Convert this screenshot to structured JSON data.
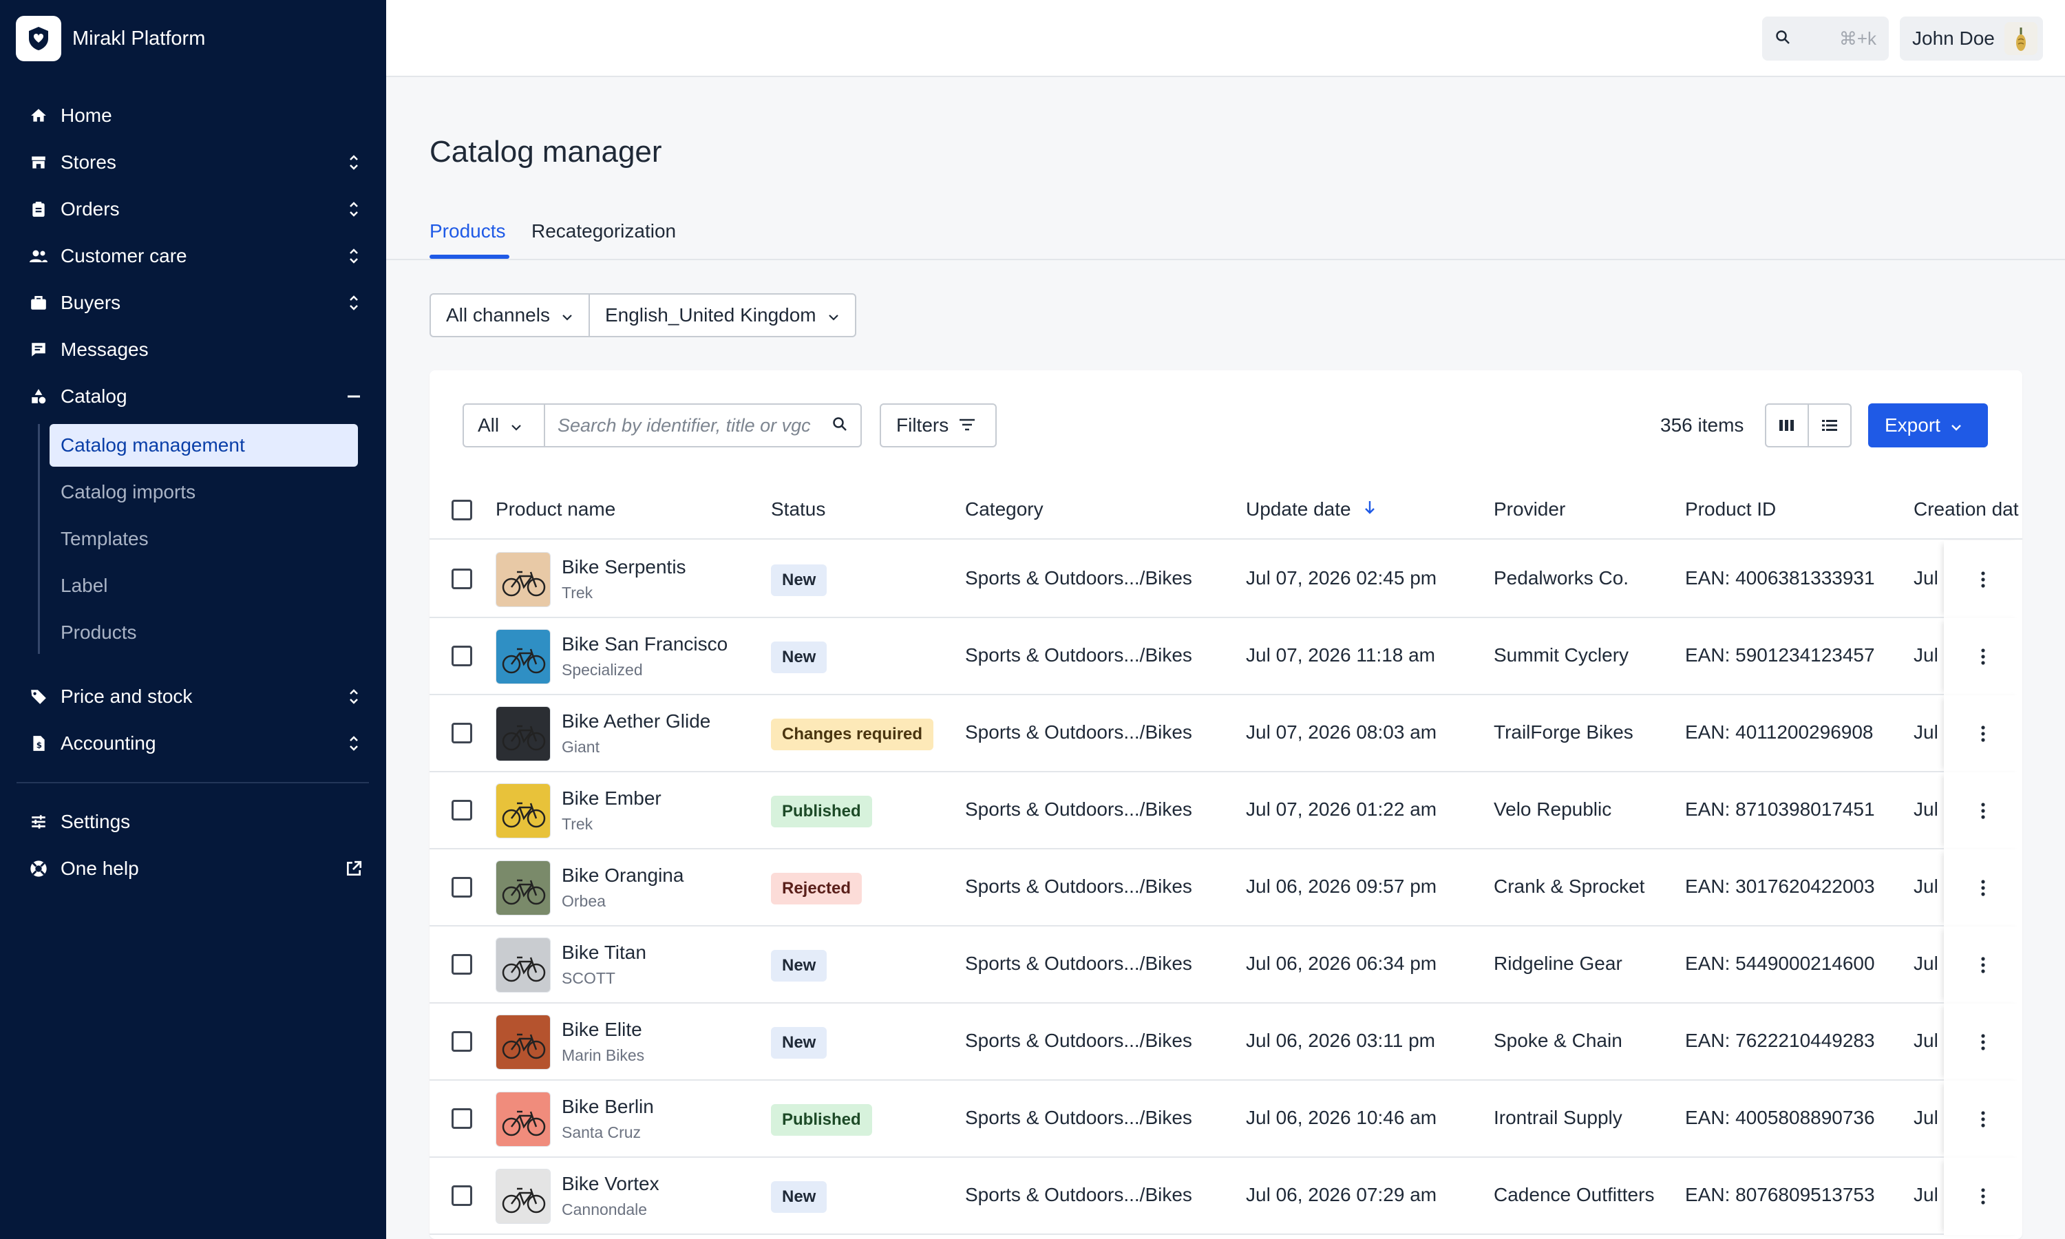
{
  "app": {
    "name": "Mirakl Platform"
  },
  "sidebar": {
    "items": [
      {
        "label": "Home",
        "icon": "home-icon"
      },
      {
        "label": "Stores",
        "icon": "store-icon"
      },
      {
        "label": "Orders",
        "icon": "clipboard-icon"
      },
      {
        "label": "Customer care",
        "icon": "people-icon"
      },
      {
        "label": "Buyers",
        "icon": "briefcase-icon"
      },
      {
        "label": "Messages",
        "icon": "message-icon"
      },
      {
        "label": "Catalog",
        "icon": "shapes-icon"
      },
      {
        "label": "Price and stock",
        "icon": "tag-icon"
      },
      {
        "label": "Accounting",
        "icon": "invoice-icon"
      },
      {
        "label": "Settings",
        "icon": "sliders-icon"
      },
      {
        "label": "One help",
        "icon": "lifebuoy-icon"
      }
    ],
    "catalog_sub": [
      {
        "label": "Catalog management",
        "active": true
      },
      {
        "label": "Catalog imports",
        "active": false
      },
      {
        "label": "Templates",
        "active": false
      },
      {
        "label": "Label",
        "active": false
      },
      {
        "label": "Products",
        "active": false
      }
    ]
  },
  "topbar": {
    "search_shortcut": "⌘+k",
    "user_name": "John Doe"
  },
  "page": {
    "title": "Catalog manager",
    "tabs": [
      {
        "label": "Products",
        "active": true
      },
      {
        "label": "Recategorization",
        "active": false
      }
    ],
    "channel_selector": "All channels",
    "locale_selector": "English_United Kingdom"
  },
  "toolbar": {
    "scope_filter": "All",
    "search_placeholder": "Search by identifier, title or vgc",
    "filters_label": "Filters",
    "items_count": "356 items",
    "export_label": "Export"
  },
  "table": {
    "columns": [
      "Product name",
      "Status",
      "Category",
      "Update date",
      "Provider",
      "Product ID",
      "Creation dat"
    ],
    "creation_cut": "Jul",
    "rows": [
      {
        "name": "Bike Serpentis",
        "brand": "Trek",
        "status": "New",
        "category": "Sports & Outdoors.../Bikes",
        "update": "Jul 07, 2026 02:45 pm",
        "provider": "Pedalworks Co.",
        "product_id": "EAN: 4006381333931",
        "thumb": "#e8c9a6"
      },
      {
        "name": "Bike San Francisco",
        "brand": "Specialized",
        "status": "New",
        "category": "Sports & Outdoors.../Bikes",
        "update": "Jul 07, 2026 11:18 am",
        "provider": "Summit Cyclery",
        "product_id": "EAN: 5901234123457",
        "thumb": "#2f8fc4"
      },
      {
        "name": "Bike Aether Glide",
        "brand": "Giant",
        "status": "Changes required",
        "category": "Sports & Outdoors.../Bikes",
        "update": "Jul 07, 2026 08:03 am",
        "provider": "TrailForge Bikes",
        "product_id": "EAN: 4011200296908",
        "thumb": "#2b2e33"
      },
      {
        "name": "Bike Ember",
        "brand": "Trek",
        "status": "Published",
        "category": "Sports & Outdoors.../Bikes",
        "update": "Jul 07, 2026 01:22 am",
        "provider": "Velo Republic",
        "product_id": "EAN: 8710398017451",
        "thumb": "#e8c23a"
      },
      {
        "name": "Bike Orangina",
        "brand": "Orbea",
        "status": "Rejected",
        "category": "Sports & Outdoors.../Bikes",
        "update": "Jul 06, 2026 09:57 pm",
        "provider": "Crank & Sprocket",
        "product_id": "EAN: 3017620422003",
        "thumb": "#7a8a6a"
      },
      {
        "name": "Bike Titan",
        "brand": "SCOTT",
        "status": "New",
        "category": "Sports & Outdoors.../Bikes",
        "update": "Jul 06, 2026 06:34 pm",
        "provider": "Ridgeline Gear",
        "product_id": "EAN: 5449000214600",
        "thumb": "#c9ccd0"
      },
      {
        "name": "Bike Elite",
        "brand": "Marin Bikes",
        "status": "New",
        "category": "Sports & Outdoors.../Bikes",
        "update": "Jul 06, 2026 03:11 pm",
        "provider": "Spoke & Chain",
        "product_id": "EAN: 7622210449283",
        "thumb": "#b5532e"
      },
      {
        "name": "Bike Berlin",
        "brand": "Santa Cruz",
        "status": "Published",
        "category": "Sports & Outdoors.../Bikes",
        "update": "Jul 06, 2026 10:46 am",
        "provider": "Irontrail Supply",
        "product_id": "EAN: 4005808890736",
        "thumb": "#f08c7c"
      },
      {
        "name": "Bike Vortex",
        "brand": "Cannondale",
        "status": "New",
        "category": "Sports & Outdoors.../Bikes",
        "update": "Jul 06, 2026 07:29 am",
        "provider": "Cadence Outfitters",
        "product_id": "EAN: 8076809513753",
        "thumb": "#e4e4e4"
      }
    ]
  },
  "status_colors": {
    "New": {
      "bg": "#e4ecf9",
      "fg": "#1f2937"
    },
    "Changes required": {
      "bg": "#fde9b8",
      "fg": "#4a3510"
    },
    "Published": {
      "bg": "#d7f2dc",
      "fg": "#1d4a27"
    },
    "Rejected": {
      "bg": "#fcdcd8",
      "fg": "#5a1f1a"
    }
  },
  "colors": {
    "sidebar_bg": "#05183a",
    "accent": "#1f5ae6"
  }
}
